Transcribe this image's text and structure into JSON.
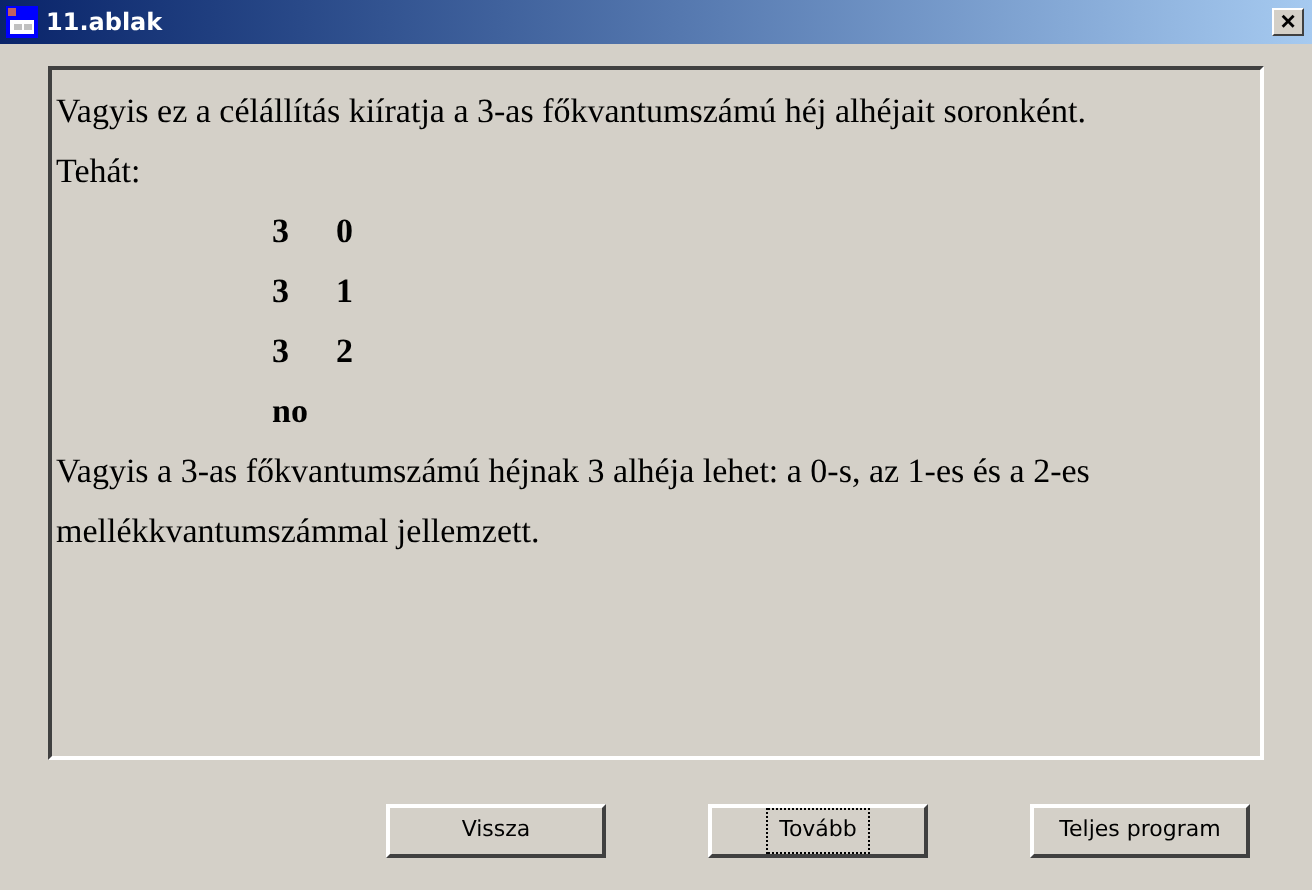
{
  "window": {
    "title": "11.ablak",
    "close": "×"
  },
  "lines": [
    {
      "kind": "text",
      "text": "Vagyis ez a célállítás kiíratja a 3-as főkvantumszámú héj alhéjait soronként."
    },
    {
      "kind": "text",
      "text": "Tehát:"
    },
    {
      "kind": "result",
      "cells": [
        "3",
        "0"
      ]
    },
    {
      "kind": "result",
      "cells": [
        "3",
        "1"
      ]
    },
    {
      "kind": "result",
      "cells": [
        "3",
        "2"
      ]
    },
    {
      "kind": "result",
      "cells": [
        "no"
      ]
    },
    {
      "kind": "text",
      "text": "Vagyis a 3-as főkvantumszámú héjnak 3 alhéja lehet: a 0-s, az 1-es és a 2-es"
    },
    {
      "kind": "text",
      "text": "mellékkvantumszámmal jellemzett."
    }
  ],
  "buttons": [
    {
      "label": "Vissza",
      "focused": false
    },
    {
      "label": "Tovább",
      "focused": true
    },
    {
      "label": "Teljes program",
      "focused": false
    }
  ]
}
